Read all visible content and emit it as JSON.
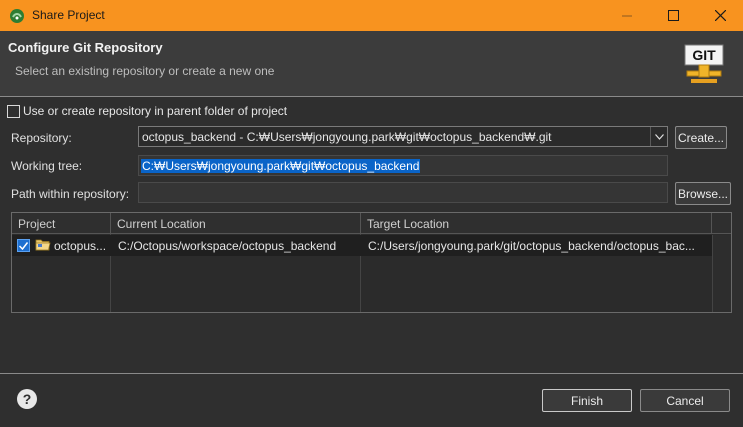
{
  "window": {
    "title": "Share Project",
    "title_bar_color": "#f8931f"
  },
  "header": {
    "title": "Configure Git Repository",
    "subtitle": "Select an existing repository or create a new one",
    "logo_text": "GIT"
  },
  "form": {
    "parent_checkbox_label": "Use or create repository in parent folder of project",
    "parent_checkbox_checked": false,
    "repository_label": "Repository:",
    "repository_value": "octopus_backend - C:₩Users₩jongyoung.park₩git₩octopus_backend₩.git",
    "create_button": "Create...",
    "working_tree_label": "Working tree:",
    "working_tree_value": "C:₩Users₩jongyoung.park₩git₩octopus_backend",
    "path_label": "Path within repository:",
    "path_value": "",
    "browse_button": "Browse..."
  },
  "table": {
    "columns": [
      "Project",
      "Current Location",
      "Target Location"
    ],
    "rows": [
      {
        "checked": true,
        "project": "octopus...",
        "current_location": "C:/Octopus/workspace/octopus_backend",
        "target_location": "C:/Users/jongyoung.park/git/octopus_backend/octopus_bac..."
      }
    ]
  },
  "footer": {
    "help_icon": "?",
    "finish_button": "Finish",
    "cancel_button": "Cancel"
  },
  "colors": {
    "accent": "#f8931f",
    "selection": "#0a64c8",
    "background": "#2f2f2f"
  }
}
